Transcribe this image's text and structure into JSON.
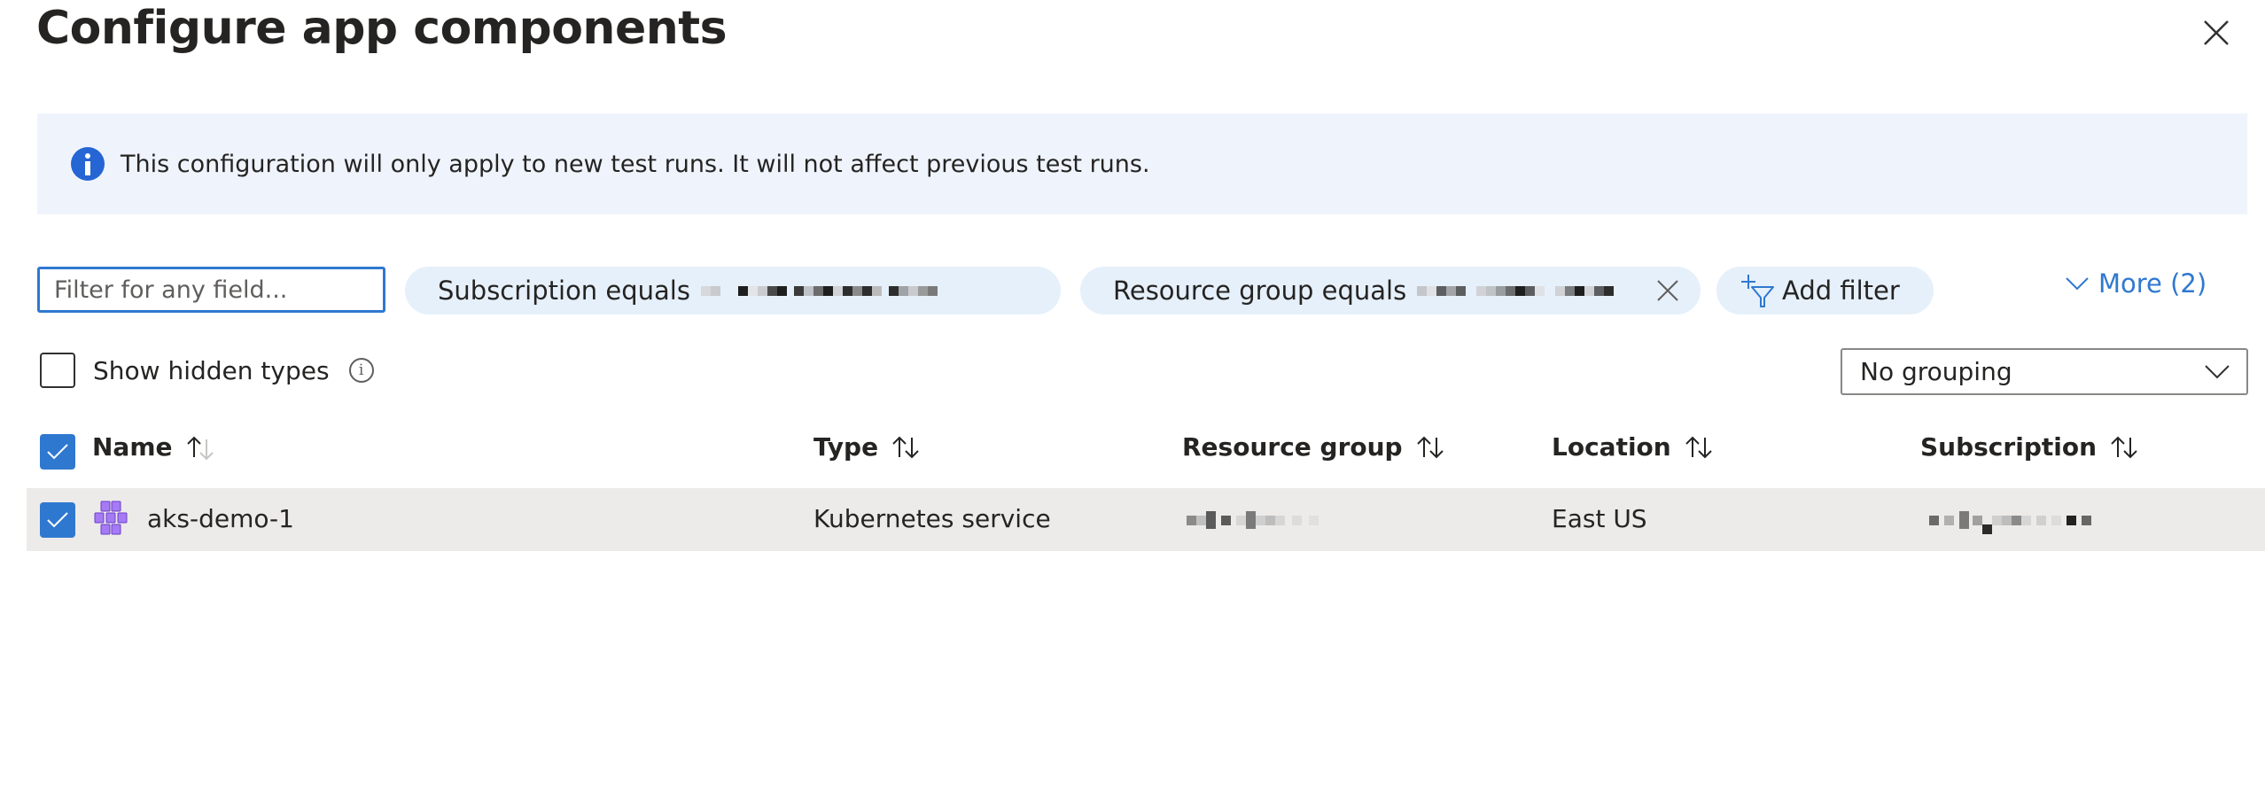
{
  "dialog": {
    "title": "Configure app components",
    "close_label": "Close"
  },
  "banner": {
    "icon": "info-icon",
    "text": "This configuration will only apply to new test runs. It will not affect previous test runs."
  },
  "filters": {
    "search_placeholder": "Filter for any field...",
    "search_value": "",
    "pills": [
      {
        "label": "Subscription equals",
        "value_redacted": true,
        "removable": false
      },
      {
        "label": "Resource group equals",
        "value_redacted": true,
        "removable": true
      }
    ],
    "add_filter_label": "Add filter",
    "more_label": "More (2)"
  },
  "options": {
    "show_hidden_label": "Show hidden types",
    "show_hidden_checked": false,
    "grouping_value": "No grouping"
  },
  "table": {
    "select_all_checked": true,
    "columns": [
      {
        "label": "Name",
        "sort": "ascending"
      },
      {
        "label": "Type",
        "sort": "none"
      },
      {
        "label": "Resource group",
        "sort": "none"
      },
      {
        "label": "Location",
        "sort": "none"
      },
      {
        "label": "Subscription",
        "sort": "none"
      }
    ],
    "rows": [
      {
        "checked": true,
        "icon": "kubernetes-service-icon",
        "name": "aks-demo-1",
        "type": "Kubernetes service",
        "resource_group": "[redacted]",
        "location": "East US",
        "subscription": "[redacted]"
      }
    ]
  },
  "colors": {
    "accent": "#2f78d0",
    "banner_bg": "#eff4fc",
    "pill_bg": "#e6f0fa",
    "row_selected_bg": "#edebe9",
    "info_icon": "#2565d4",
    "aks_purple": "#8b5cf6"
  }
}
